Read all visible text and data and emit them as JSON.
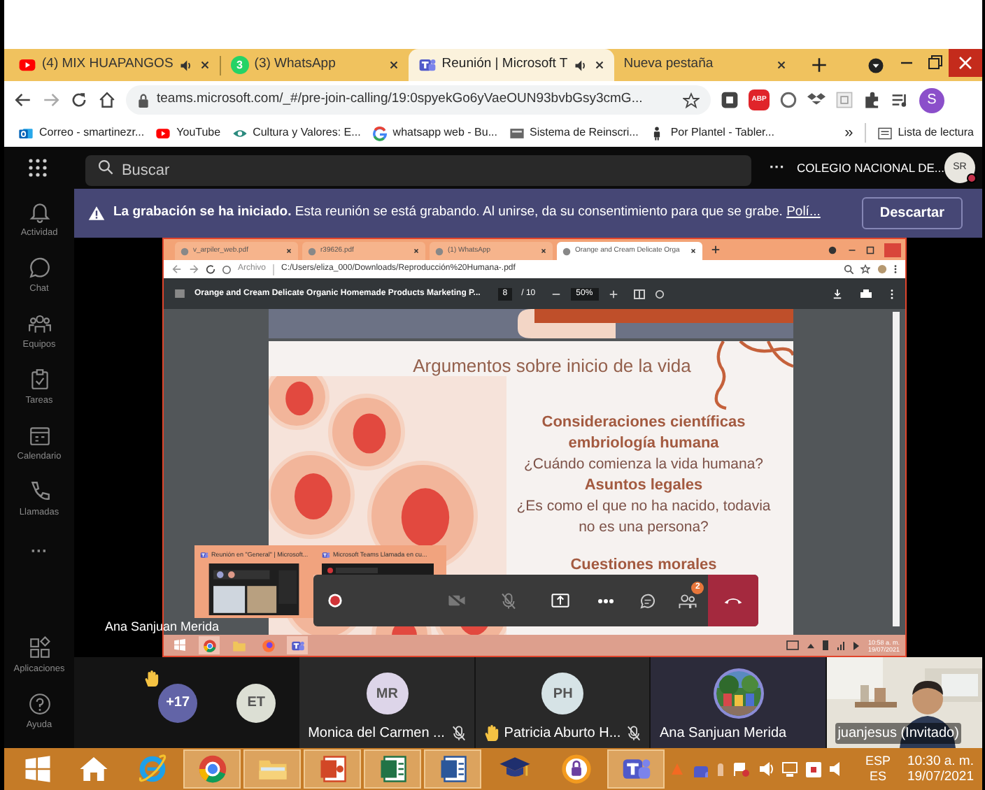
{
  "browser": {
    "tabs": [
      {
        "title": "(4) MIX HUAPANGOS",
        "audio": true,
        "selected": false
      },
      {
        "title": "(3) WhatsApp",
        "badge": "3",
        "audio": false,
        "selected": false
      },
      {
        "title": "Reunión | Microsoft T",
        "audio": true,
        "selected": true
      },
      {
        "title": "Nueva pestaña",
        "audio": false,
        "selected": false
      }
    ],
    "url": "teams.microsoft.com/_#/pre-join-calling/19:0spyekGo6yVaeOUN93bvbGsy3cmG...",
    "adblock_label": "ABP",
    "profile_initial": "S",
    "bookmarks": [
      {
        "label": "Correo - smartinezr..."
      },
      {
        "label": "YouTube"
      },
      {
        "label": "Cultura y Valores: E..."
      },
      {
        "label": "whatsapp web - Bu..."
      },
      {
        "label": "Sistema de Reinscri..."
      },
      {
        "label": "Por Plantel - Tabler..."
      }
    ],
    "bookmarks_overflow": "»",
    "reading_list": "Lista de lectura"
  },
  "teams": {
    "search": {
      "placeholder": "Buscar"
    },
    "more": "···",
    "organization": "COLEGIO NACIONAL DE...",
    "avatar": "SR",
    "rail": [
      {
        "label": "Actividad"
      },
      {
        "label": "Chat"
      },
      {
        "label": "Equipos"
      },
      {
        "label": "Tareas"
      },
      {
        "label": "Calendario"
      },
      {
        "label": "Llamadas"
      }
    ],
    "rail_more": "···",
    "rail_bottom": [
      {
        "label": "Aplicaciones"
      },
      {
        "label": "Ayuda"
      }
    ],
    "banner": {
      "text": "**La grabación se ha iniciado.** Esta reunión se está grabando. Al unirse, da su consentimiento para que se grabe.",
      "link": "Polí...",
      "button": "Descartar"
    },
    "presenter": "Ana Sanjuan Merida",
    "participants": [
      {
        "kind": "overflow",
        "label": "+17",
        "hand_raised": true
      },
      {
        "kind": "avatar",
        "initials": "ET",
        "color": "#dcdfd4"
      },
      {
        "kind": "avatar",
        "initials": "MR",
        "color": "#ddd5e9",
        "name": "Monica del Carmen ...",
        "muted": true
      },
      {
        "kind": "avatar",
        "initials": "PH",
        "color": "#d6e3e6",
        "name": "Patricia Aburto H...",
        "muted": true,
        "hand_raised": true
      },
      {
        "name": "Ana Sanjuan Merida",
        "speaking": true
      },
      {
        "kind": "video",
        "name": "juanjesus (Invitado)"
      }
    ]
  },
  "shared_screen": {
    "tabs": [
      {
        "title": "v_arpiler_web.pdf",
        "selected": false
      },
      {
        "title": "r39626.pdf",
        "selected": false
      },
      {
        "title": "(1) WhatsApp",
        "selected": false
      },
      {
        "title": "Orange and Cream Delicate Orga",
        "selected": true
      }
    ],
    "scheme": "Archivo",
    "path": "C:/Users/eliza_000/Downloads/Reproducción%20Humana-.pdf",
    "pdf": {
      "title": "Orange and Cream Delicate Organic Homemade Products Marketing P...",
      "page": "8",
      "pages": "/ 10",
      "zoom": "50%"
    },
    "slide": {
      "title": "Argumentos sobre inicio de la vida",
      "lines": [
        {
          "kind": "heading",
          "text": "Consideraciones científicas embriología humana"
        },
        {
          "kind": "body",
          "text": "¿Cuándo comienza la vida humana?"
        },
        {
          "kind": "heading",
          "text": "Asuntos legales"
        },
        {
          "kind": "body",
          "text": "¿Es como el que no ha nacido, todavia no es una persona?"
        },
        {
          "kind": "heading",
          "text": "Cuestiones morales"
        }
      ]
    },
    "previews": [
      {
        "title": "Reunión en \"General\" | Microsoft..."
      },
      {
        "title": "Microsoft Teams Llamada en cu..."
      }
    ],
    "people_badge": "2",
    "taskbar_apps": [
      {
        "selected": false
      },
      {
        "selected": true
      },
      {
        "selected": false
      },
      {
        "selected": false
      },
      {
        "selected": true
      }
    ],
    "time": "10:58 a. m.",
    "date": "19/07/2021"
  },
  "taskbar": {
    "apps": [
      {
        "selected": false
      },
      {
        "selected": false
      },
      {
        "selected": false
      },
      {
        "selected": true
      },
      {
        "selected": true
      },
      {
        "selected": true
      },
      {
        "selected": true
      },
      {
        "selected": true
      },
      {
        "selected": false
      },
      {
        "selected": false
      },
      {
        "selected": true
      }
    ],
    "language": "ESP",
    "layout": "ES",
    "time": "10:30 a. m.",
    "date": "19/07/2021"
  }
}
